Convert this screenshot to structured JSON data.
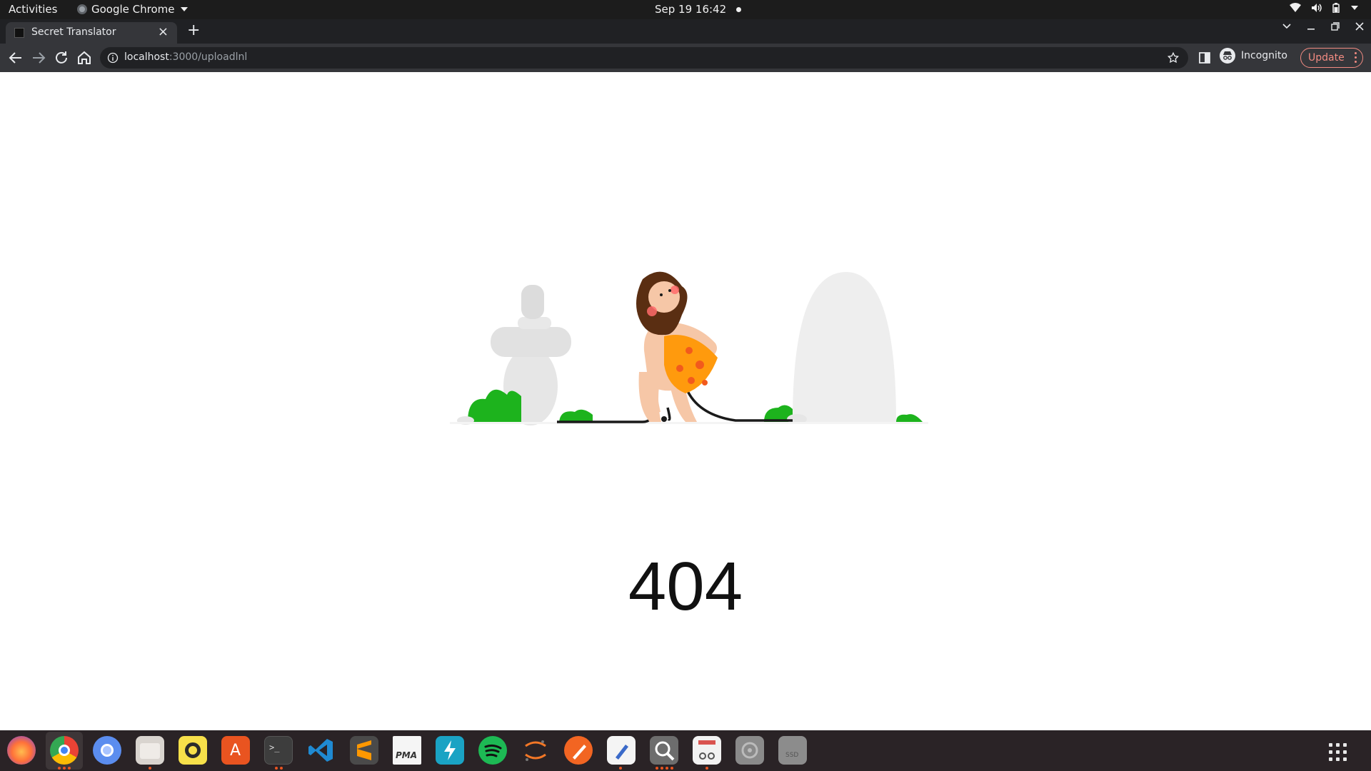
{
  "topbar": {
    "activities": "Activities",
    "app_name": "Google Chrome",
    "datetime": "Sep 19  16:42"
  },
  "tab": {
    "title": "Secret Translator",
    "close": "×"
  },
  "new_tab": "+",
  "address": {
    "host": "localhost",
    "path": ":3000/uploadlnl"
  },
  "toolbar": {
    "profile_label": "Incognito",
    "update_label": "Update"
  },
  "page": {
    "error_code": "404"
  },
  "dock": {
    "items": [
      "firefox-icon",
      "chrome-icon",
      "chromium-icon",
      "files-icon",
      "rhythmbox-icon",
      "app-center-icon",
      "terminal-icon",
      "vscode-icon",
      "sublime-text-icon",
      "phpmyadmin-icon",
      "postman-icon",
      "spotify-icon",
      "jupyter-icon",
      "inkscape-icon",
      "text-editor-icon",
      "image-viewer-icon",
      "document-viewer-icon",
      "disks-icon",
      "ssd-icon"
    ],
    "ssd_label": "SSD",
    "pma_label": "PMA"
  },
  "colors": {
    "topbar": "#1c1c1c",
    "tabstrip": "#202124",
    "toolbar": "#35363a",
    "update_accent": "#f28b82",
    "dock": "#2a2326",
    "ubuntu_orange": "#e95420"
  }
}
